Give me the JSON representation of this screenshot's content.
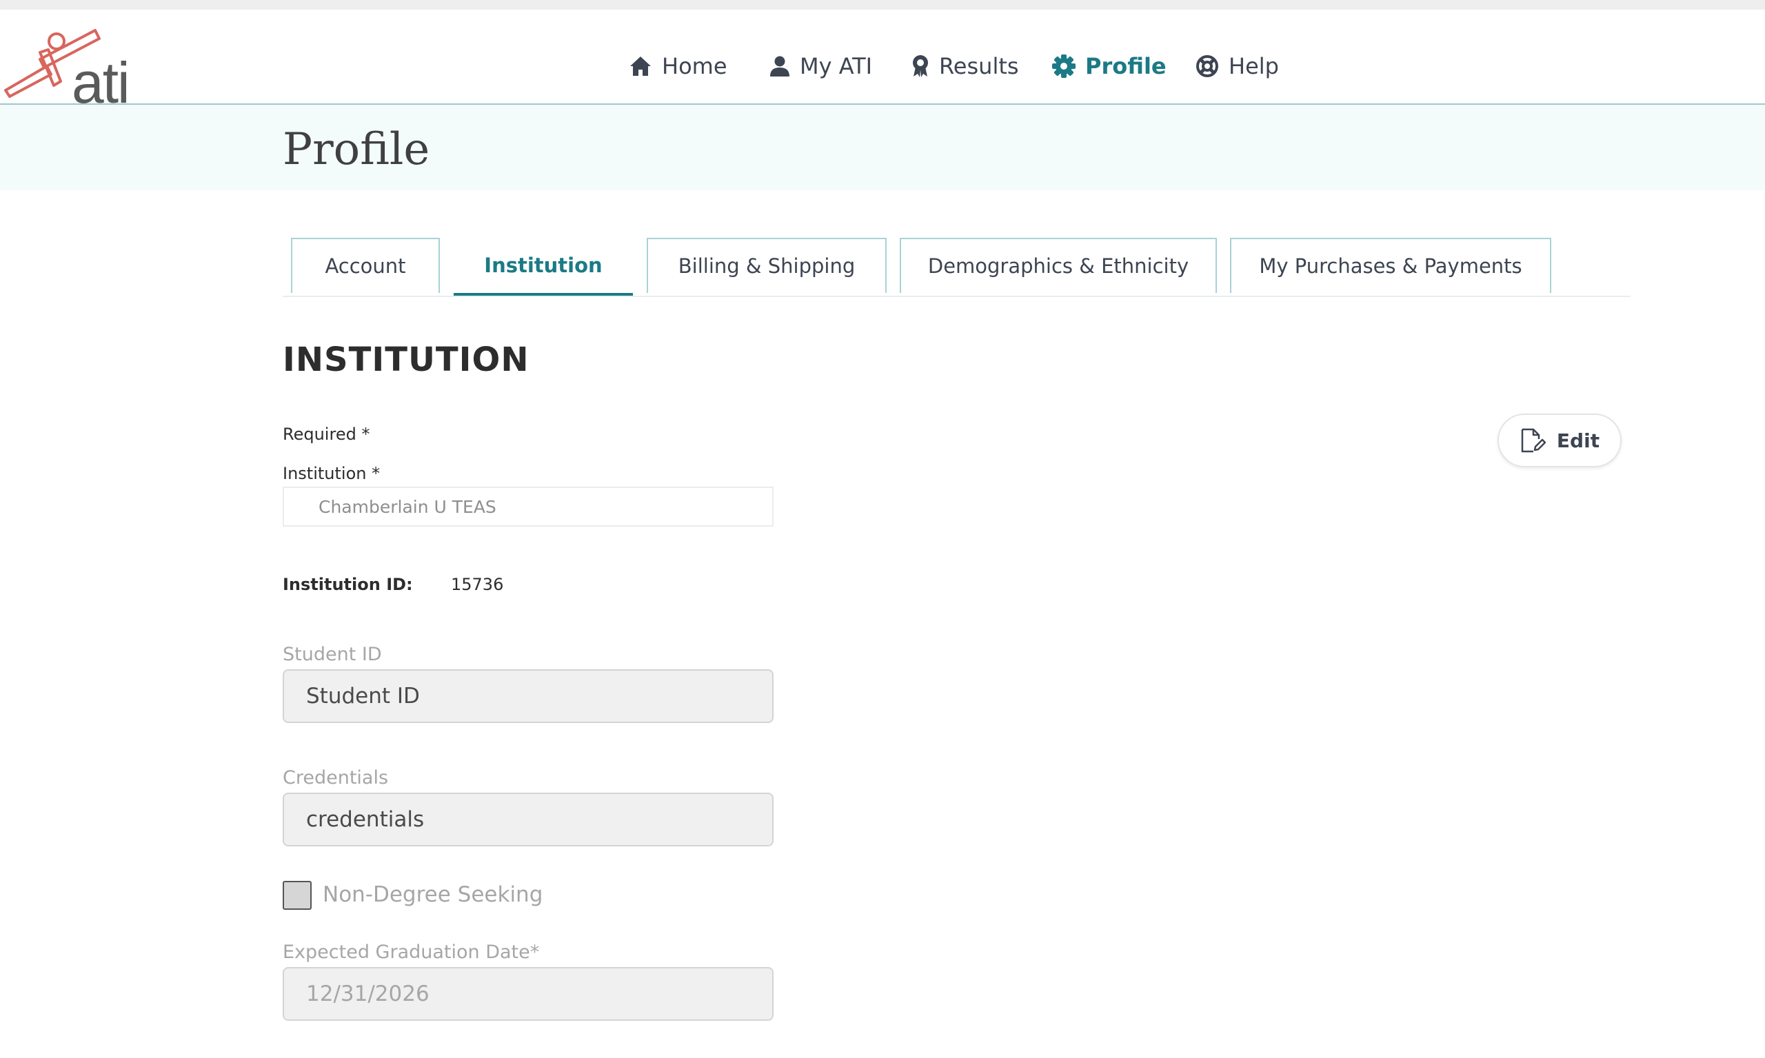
{
  "header": {
    "logo_text": "ati",
    "nav": [
      {
        "label": "Home",
        "icon": "home-icon"
      },
      {
        "label": "My ATI",
        "icon": "user-icon"
      },
      {
        "label": "Results",
        "icon": "award-icon"
      },
      {
        "label": "Profile",
        "icon": "gear-icon",
        "active": true
      },
      {
        "label": "Help",
        "icon": "lifebuoy-icon"
      }
    ]
  },
  "page": {
    "title": "Profile"
  },
  "tabs": [
    {
      "label": "Account"
    },
    {
      "label": "Institution",
      "active": true
    },
    {
      "label": "Billing & Shipping"
    },
    {
      "label": "Demographics & Ethnicity"
    },
    {
      "label": "My Purchases & Payments"
    }
  ],
  "section": {
    "title": "INSTITUTION",
    "required_note": "Required *",
    "edit_label": "Edit"
  },
  "form": {
    "institution_label": "Institution *",
    "institution_value": "Chamberlain U TEAS",
    "institution_id_label": "Institution ID:",
    "institution_id_value": "15736",
    "student_id_label": "Student ID",
    "student_id_placeholder": "Student ID",
    "credentials_label": "Credentials",
    "credentials_placeholder": "credentials",
    "non_degree_label": "Non-Degree Seeking",
    "non_degree_checked": false,
    "grad_date_label": "Expected Graduation Date*",
    "grad_date_value": "12/31/2026"
  },
  "colors": {
    "accent": "#1b7a86",
    "nav_text": "#3d4452",
    "logo_red": "#d8665d",
    "subheader_bg": "#f3fbfb"
  }
}
